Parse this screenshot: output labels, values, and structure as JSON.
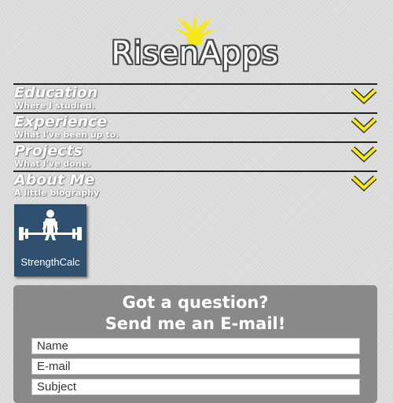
{
  "header": {
    "logo_text": "RisenApps"
  },
  "nav": {
    "items": [
      {
        "title": "Education",
        "subtitle": "Where I studied."
      },
      {
        "title": "Experience",
        "subtitle": "What I've been up to."
      },
      {
        "title": "Projects",
        "subtitle": "What I've done."
      },
      {
        "title": "About Me",
        "subtitle": "A little biography"
      }
    ]
  },
  "apps": [
    {
      "name": "StrengthCalc",
      "icon": "weightlifter-icon"
    }
  ],
  "contact": {
    "title_line1": "Got a question?",
    "title_line2": "Send me an E-mail!",
    "name_placeholder": "Name",
    "email_placeholder": "E-mail",
    "subject_placeholder": "Subject"
  },
  "colors": {
    "accent": "#f5e81c",
    "tile_background": "#2f4f6f",
    "panel_background": "#898989"
  }
}
